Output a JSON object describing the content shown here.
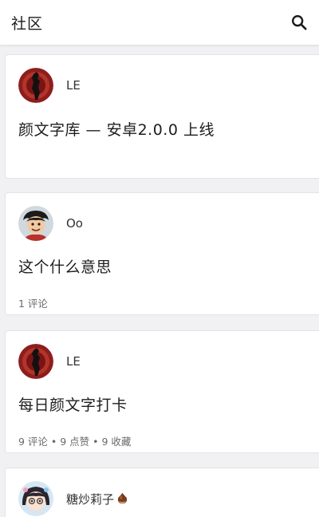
{
  "appbar": {
    "title": "社区",
    "search_icon": "search-icon"
  },
  "posts": [
    {
      "author": "LE",
      "avatar": "red-circle-figure-avatar",
      "title": "颜文字库 — 安卓2.0.0 上线",
      "meta": ""
    },
    {
      "author": "Oo",
      "avatar": "anime-character-avatar",
      "title": "这个什么意思",
      "meta": "1 评论"
    },
    {
      "author": "LE",
      "avatar": "red-circle-figure-avatar",
      "title": "每日颜文字打卡",
      "meta": "9 评论 • 9 点赞 • 9 收藏"
    },
    {
      "author": "糖炒莉子",
      "author_suffix_icon": "chestnut-icon",
      "avatar": "anime-girl-avatar",
      "title": "",
      "meta": ""
    }
  ],
  "colors": {
    "background": "#f1f1f3",
    "card": "#ffffff",
    "avatar_red": "#8e1d1d"
  }
}
